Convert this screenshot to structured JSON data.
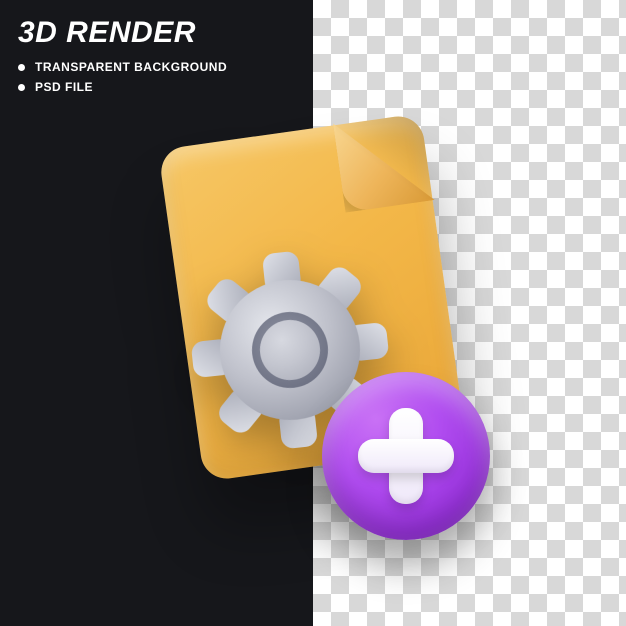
{
  "header": {
    "title": "3D RENDER",
    "bullets": [
      "TRANSPARENT BACKGROUND",
      "PSD FILE"
    ]
  },
  "icon": {
    "document": "file-icon",
    "gear": "gear-icon",
    "badge": "plus-badge-icon",
    "colors": {
      "document": "#f3b748",
      "gear": "#b9bbc4",
      "badge": "#a63fe6",
      "plus": "#ffffff"
    }
  }
}
